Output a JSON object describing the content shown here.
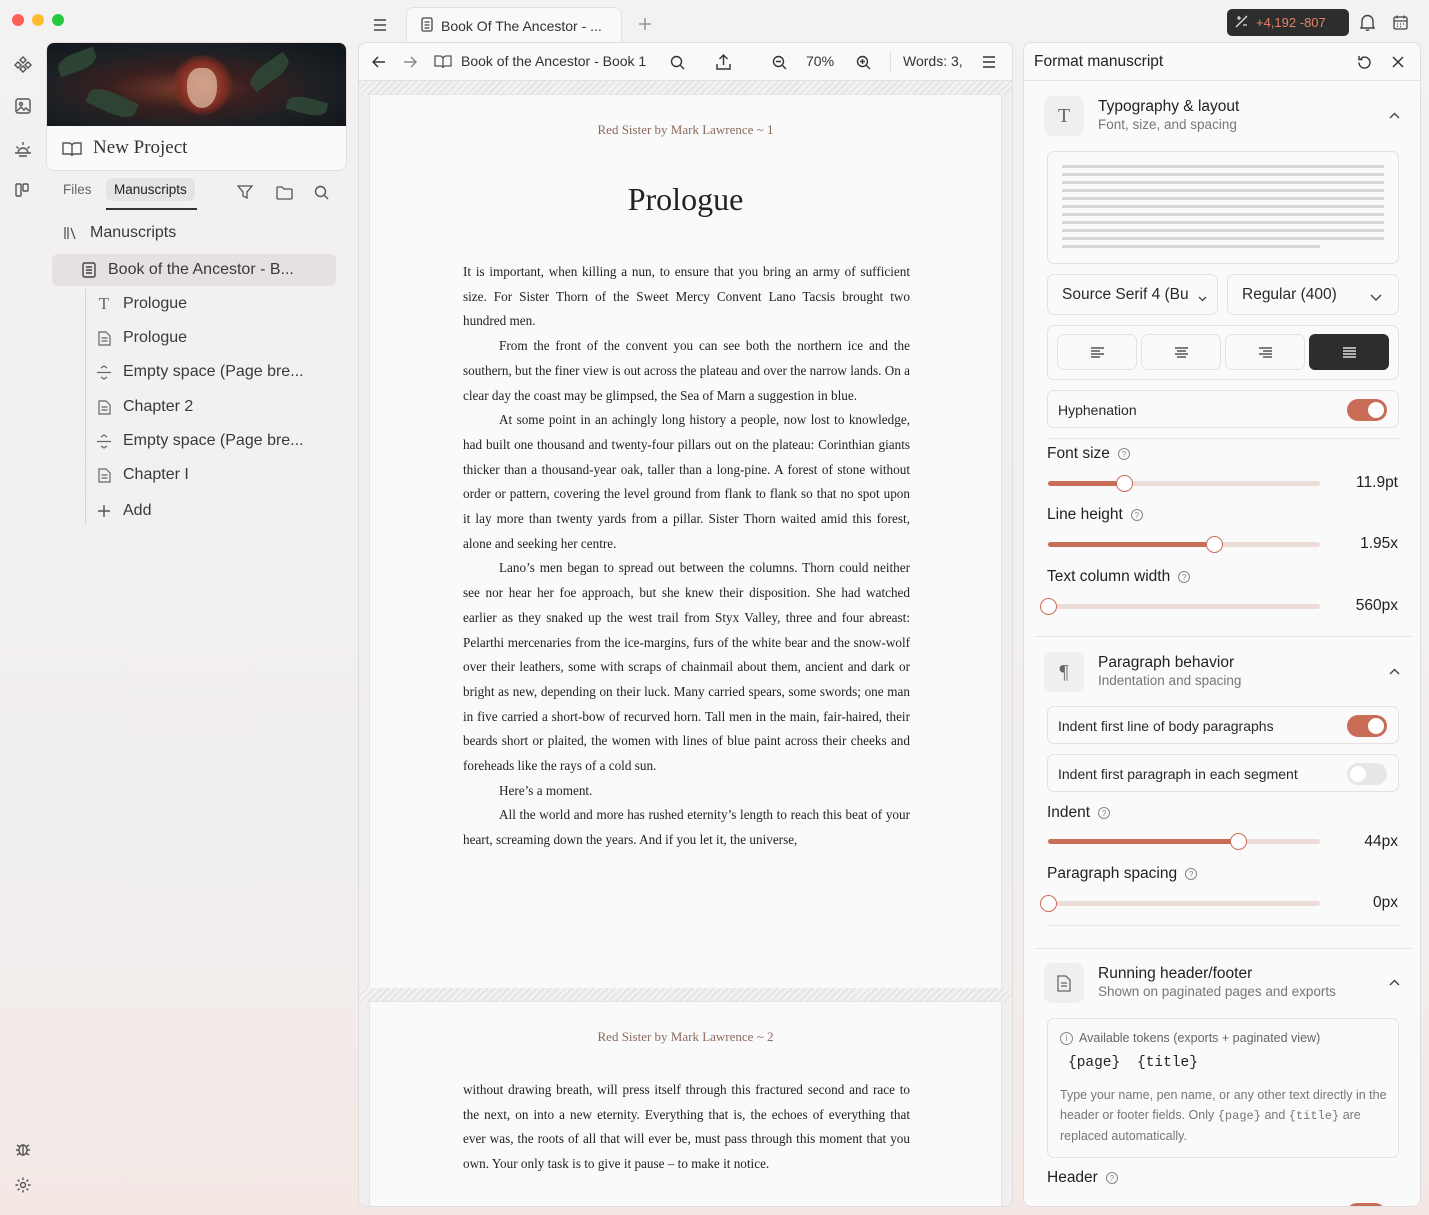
{
  "window": {
    "title_tab": "Book Of The Ancestor - ...",
    "stats": "+4,192 -807"
  },
  "sidebar": {
    "project_title": "New Project",
    "tabs": [
      "Files",
      "Manuscripts"
    ],
    "tree_root": "Manuscripts",
    "items": [
      {
        "label": "Book of the Ancestor - B...",
        "icon": "book-icon"
      },
      {
        "label": "Prologue",
        "icon": "text-icon"
      },
      {
        "label": "Prologue",
        "icon": "document-icon"
      },
      {
        "label": "Empty space (Page bre...",
        "icon": "page-break-icon"
      },
      {
        "label": "Chapter 2",
        "icon": "document-icon"
      },
      {
        "label": "Empty space (Page bre...",
        "icon": "page-break-icon"
      },
      {
        "label": "Chapter I",
        "icon": "document-icon"
      },
      {
        "label": "Add",
        "icon": "plus-icon"
      }
    ]
  },
  "editor": {
    "breadcrumb": "Book of the Ancestor - Book 1",
    "zoom": "70%",
    "words": "Words: 3,",
    "page1": {
      "running_head": "Red Sister by Mark Lawrence ~ 1",
      "chapter_title": "Prologue",
      "paragraphs": [
        "It is important, when killing a nun, to ensure that you bring an army of suf­ficient size. For Sister Thorn of the Sweet Mercy Convent Lano Tacsis brought two hundred men.",
        "From the front of the convent you can see both the northern ice and the southern, but the finer view is out across the plateau and over the nar­row lands. On a clear day the coast may be glimpsed, the Sea of Marn a sug­gestion in blue.",
        "At some point in an achingly long history a people, now lost to knowl­edge, had built one thousand and twenty-four pillars out on the plateau: Corinthian giants thicker than a thousand-year oak, taller than a long-pine. A forest of stone without order or pattern, covering the level ground from flank to flank so that no spot upon it lay more than twenty yards from a pil­lar. Sister Thorn waited amid this forest, alone and seeking her centre.",
        "Lano’s men began to spread out between the columns. Thorn could neither see nor hear her foe approach, but she knew their disposition. She had watched earlier as they snaked up the west trail from Styx Valley, three and four abreast: Pelarthi mercenaries from the ice-margins, furs of the white bear and the snow-wolf over their leathers, some with scraps of chainmail about them, ancient and dark or bright as new, depending on their luck. Many carried spears, some swords; one man in five carried a short-bow of recurved horn. Tall men in the main, fair-haired, their beards short or plaited, the women with lines of blue paint across their cheeks and foreheads like the rays of a cold sun.",
        "Here’s a moment.",
        "All the world and more has rushed eternity’s length to reach this beat of your heart, screaming down the years. And if you let it, the universe,"
      ]
    },
    "page2": {
      "running_head": "Red Sister by Mark Lawrence ~ 2",
      "paragraphs": [
        "without drawing breath, will press itself through this fractured second and race to the next, on into a new eternity. Everything that is, the echoes of everything that ever was, the roots of all that will ever be, must pass through this moment that you own. Your only task is to give it pause – to make it notice."
      ]
    }
  },
  "panel": {
    "title": "Format manuscript",
    "typography": {
      "title": "Typography & layout",
      "subtitle": "Font, size, and spacing",
      "font_family": "Source Serif 4 (Bu",
      "font_weight": "Regular (400)",
      "alignment_selected": "justify",
      "hyphenation_label": "Hyphenation",
      "hyphenation_on": true,
      "font_size_label": "Font size",
      "font_size_value": "11.9pt",
      "font_size_level": 0.28,
      "line_height_label": "Line height",
      "line_height_value": "1.95x",
      "line_height_level": 0.61,
      "column_width_label": "Text column width",
      "column_width_value": "560px",
      "column_width_level": 0.0
    },
    "paragraph": {
      "title": "Paragraph behavior",
      "subtitle": "Indentation and spacing",
      "indent_first_label": "Indent first line of body paragraphs",
      "indent_first_on": true,
      "indent_segment_label": "Indent first paragraph in each segment",
      "indent_segment_on": false,
      "indent_label": "Indent",
      "indent_value": "44px",
      "indent_level": 0.7,
      "spacing_label": "Paragraph spacing",
      "spacing_value": "0px",
      "spacing_level": 0.0
    },
    "header_footer": {
      "title": "Running header/footer",
      "subtitle": "Shown on paginated pages and exports",
      "tokens_label": "Available tokens (exports + paginated view)",
      "token_page": "{page}",
      "token_title": "{title}",
      "help_1": "Type your name, pen name, or any other text directly in the header or footer fields. Only",
      "help_and": "and",
      "help_2": "are replaced automatically.",
      "header_label": "Header"
    }
  },
  "colors": {
    "accent": "#c96d58",
    "dark": "#2d2d2d"
  }
}
